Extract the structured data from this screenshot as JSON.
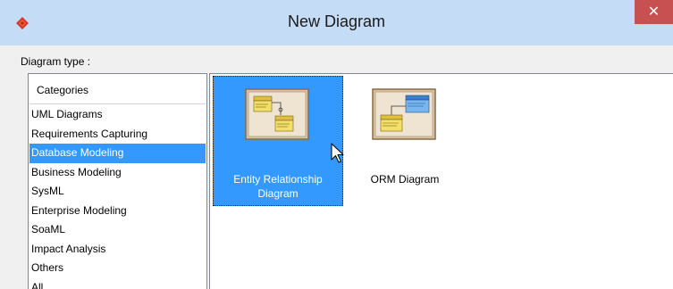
{
  "window": {
    "title": "New Diagram",
    "close_label": "✕",
    "app_icon": "visual-paradigm-logo-icon"
  },
  "form": {
    "diagram_type_label": "Diagram type :"
  },
  "categories": {
    "header": "Categories",
    "items": [
      {
        "label": "UML Diagrams",
        "selected": false
      },
      {
        "label": "Requirements Capturing",
        "selected": false
      },
      {
        "label": "Database Modeling",
        "selected": true
      },
      {
        "label": "Business Modeling",
        "selected": false
      },
      {
        "label": "SysML",
        "selected": false
      },
      {
        "label": "Enterprise Modeling",
        "selected": false
      },
      {
        "label": "SoaML",
        "selected": false
      },
      {
        "label": "Impact Analysis",
        "selected": false
      },
      {
        "label": "Others",
        "selected": false
      },
      {
        "label": "All",
        "selected": false
      }
    ]
  },
  "diagrams": {
    "items": [
      {
        "label_line1": "Entity Relationship",
        "label_line2": "Diagram",
        "selected": true,
        "icon": "erd-thumbnail-icon"
      },
      {
        "label_line1": "ORM Diagram",
        "label_line2": "",
        "selected": false,
        "icon": "orm-thumbnail-icon"
      }
    ]
  },
  "colors": {
    "selection": "#3399ff",
    "title_bar": "#c4dcf5",
    "close_button": "#c75050"
  }
}
